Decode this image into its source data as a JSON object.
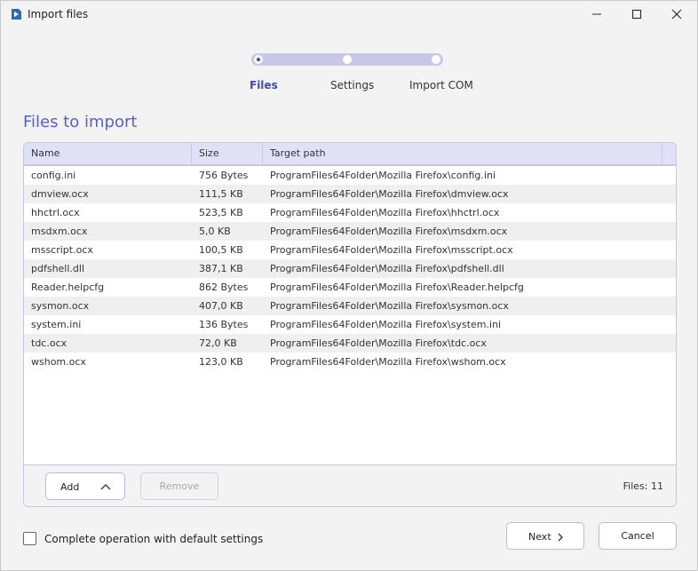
{
  "window": {
    "title": "Import files",
    "app_icon": "advanced-installer-logo-icon",
    "controls": [
      "minimize-icon",
      "maximize-icon",
      "close-icon"
    ]
  },
  "stepper": {
    "steps": [
      {
        "label": "Files",
        "state": "current"
      },
      {
        "label": "Settings",
        "state": "pending"
      },
      {
        "label": "Import COM",
        "state": "pending"
      }
    ]
  },
  "section_title": "Files to import",
  "table": {
    "columns": [
      "Name",
      "Size",
      "Target path"
    ],
    "rows": [
      {
        "name": "config.ini",
        "size": "756 Bytes",
        "path": "ProgramFiles64Folder\\Mozilla Firefox\\config.ini"
      },
      {
        "name": "dmview.ocx",
        "size": "111,5 KB",
        "path": "ProgramFiles64Folder\\Mozilla Firefox\\dmview.ocx"
      },
      {
        "name": "hhctrl.ocx",
        "size": "523,5 KB",
        "path": "ProgramFiles64Folder\\Mozilla Firefox\\hhctrl.ocx"
      },
      {
        "name": "msdxm.ocx",
        "size": "5,0 KB",
        "path": "ProgramFiles64Folder\\Mozilla Firefox\\msdxm.ocx"
      },
      {
        "name": "msscript.ocx",
        "size": "100,5 KB",
        "path": "ProgramFiles64Folder\\Mozilla Firefox\\msscript.ocx"
      },
      {
        "name": "pdfshell.dll",
        "size": "387,1 KB",
        "path": "ProgramFiles64Folder\\Mozilla Firefox\\pdfshell.dll"
      },
      {
        "name": "Reader.helpcfg",
        "size": "862 Bytes",
        "path": "ProgramFiles64Folder\\Mozilla Firefox\\Reader.helpcfg"
      },
      {
        "name": "sysmon.ocx",
        "size": "407,0 KB",
        "path": "ProgramFiles64Folder\\Mozilla Firefox\\sysmon.ocx"
      },
      {
        "name": "system.ini",
        "size": "136 Bytes",
        "path": "ProgramFiles64Folder\\Mozilla Firefox\\system.ini"
      },
      {
        "name": "tdc.ocx",
        "size": "72,0 KB",
        "path": "ProgramFiles64Folder\\Mozilla Firefox\\tdc.ocx"
      },
      {
        "name": "wshom.ocx",
        "size": "123,0 KB",
        "path": "ProgramFiles64Folder\\Mozilla Firefox\\wshom.ocx"
      }
    ]
  },
  "panel_footer": {
    "add_label": "Add",
    "remove_label": "Remove",
    "files_count": "Files: 11"
  },
  "footer": {
    "default_settings_label": "Complete operation with default settings",
    "default_settings_checked": false,
    "next_label": "Next",
    "cancel_label": "Cancel"
  },
  "colors": {
    "accent": "#5a5fc8",
    "header_bg": "#e0e1f7",
    "stepper_track": "#c8c8e6"
  }
}
